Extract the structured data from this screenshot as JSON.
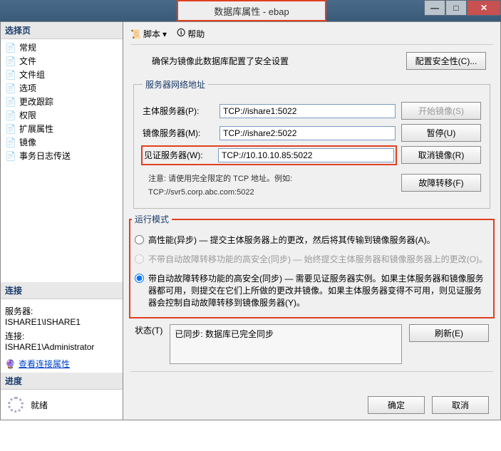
{
  "window": {
    "title": "数据库属性 - ebap"
  },
  "sidebar": {
    "select_header": "选择页",
    "items": [
      {
        "label": "常规"
      },
      {
        "label": "文件"
      },
      {
        "label": "文件组"
      },
      {
        "label": "选项"
      },
      {
        "label": "更改跟踪"
      },
      {
        "label": "权限"
      },
      {
        "label": "扩展属性"
      },
      {
        "label": "镜像"
      },
      {
        "label": "事务日志传送"
      }
    ],
    "conn_header": "连接",
    "server_label": "服务器:",
    "server_value": "ISHARE1\\ISHARE1",
    "conn_label": "连接:",
    "conn_value": "ISHARE1\\Administrator",
    "view_conn_link": "查看连接属性",
    "progress_header": "进度",
    "progress_value": "就绪"
  },
  "toolbar": {
    "script": "脚本",
    "help": "帮助"
  },
  "main": {
    "config_msg": "确保为镜像此数据库配置了安全设置",
    "config_btn": "配置安全性(C)...",
    "net_group": "服务器网络地址",
    "principal_label": "主体服务器(P):",
    "principal_value": "TCP://ishare1:5022",
    "mirror_label": "镜像服务器(M):",
    "mirror_value": "TCP://ishare2:5022",
    "witness_label": "见证服务器(W):",
    "witness_value": "TCP://10.10.10.85:5022",
    "start_btn": "开始镜像(S)",
    "pause_btn": "暂停(U)",
    "remove_btn": "取消镜像(R)",
    "failover_btn": "故障转移(F)",
    "note1": "注意: 请使用完全限定的 TCP 地址。例如:",
    "note2": "TCP://svr5.corp.abc.com:5022",
    "run_group": "运行模式",
    "opt_a": "高性能(异步) — 提交主体服务器上的更改，然后将其传输到镜像服务器(A)。",
    "opt_b": "不带自动故障转移功能的高安全(同步) — 始终提交主体服务器和镜像服务器上的更改(O)。",
    "opt_c": "带自动故障转移功能的高安全(同步) — 需要见证服务器实例。如果主体服务器和镜像服务器都可用，则提交在它们上所做的更改并镜像。如果主体服务器变得不可用，则见证服务器会控制自动故障转移到镜像服务器(Y)。",
    "status_label": "状态(T)",
    "status_value": "已同步: 数据库已完全同步",
    "refresh_btn": "刷新(E)",
    "ok_btn": "确定",
    "cancel_btn": "取消"
  }
}
